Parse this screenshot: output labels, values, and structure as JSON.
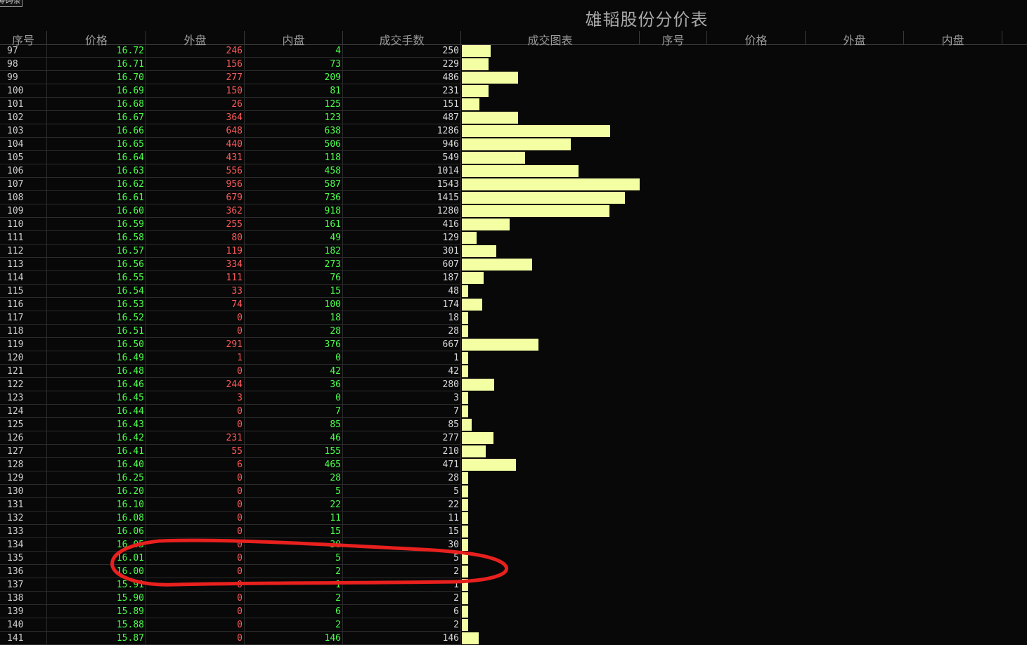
{
  "top_button": "筹码条",
  "title": "雄韬股份分价表",
  "headers_left": [
    "序号",
    "价格",
    "外盘",
    "内盘",
    "成交手数",
    "成交图表"
  ],
  "headers_right": [
    "序号",
    "价格",
    "外盘",
    "内盘"
  ],
  "colors": {
    "background": "#080808",
    "price": "#4cff4c",
    "outer": "#ff5a5a",
    "inner": "#4cff4c",
    "bar": "#f4ffa4",
    "annotation": "#e8201e"
  },
  "bar_scale_max": 1543,
  "rows": [
    {
      "idx": "97",
      "price": "16.72",
      "out": "246",
      "in": "4",
      "vol": "250"
    },
    {
      "idx": "98",
      "price": "16.71",
      "out": "156",
      "in": "73",
      "vol": "229"
    },
    {
      "idx": "99",
      "price": "16.70",
      "out": "277",
      "in": "209",
      "vol": "486"
    },
    {
      "idx": "100",
      "price": "16.69",
      "out": "150",
      "in": "81",
      "vol": "231"
    },
    {
      "idx": "101",
      "price": "16.68",
      "out": "26",
      "in": "125",
      "vol": "151"
    },
    {
      "idx": "102",
      "price": "16.67",
      "out": "364",
      "in": "123",
      "vol": "487"
    },
    {
      "idx": "103",
      "price": "16.66",
      "out": "648",
      "in": "638",
      "vol": "1286"
    },
    {
      "idx": "104",
      "price": "16.65",
      "out": "440",
      "in": "506",
      "vol": "946"
    },
    {
      "idx": "105",
      "price": "16.64",
      "out": "431",
      "in": "118",
      "vol": "549"
    },
    {
      "idx": "106",
      "price": "16.63",
      "out": "556",
      "in": "458",
      "vol": "1014"
    },
    {
      "idx": "107",
      "price": "16.62",
      "out": "956",
      "in": "587",
      "vol": "1543"
    },
    {
      "idx": "108",
      "price": "16.61",
      "out": "679",
      "in": "736",
      "vol": "1415"
    },
    {
      "idx": "109",
      "price": "16.60",
      "out": "362",
      "in": "918",
      "vol": "1280"
    },
    {
      "idx": "110",
      "price": "16.59",
      "out": "255",
      "in": "161",
      "vol": "416"
    },
    {
      "idx": "111",
      "price": "16.58",
      "out": "80",
      "in": "49",
      "vol": "129"
    },
    {
      "idx": "112",
      "price": "16.57",
      "out": "119",
      "in": "182",
      "vol": "301"
    },
    {
      "idx": "113",
      "price": "16.56",
      "out": "334",
      "in": "273",
      "vol": "607"
    },
    {
      "idx": "114",
      "price": "16.55",
      "out": "111",
      "in": "76",
      "vol": "187"
    },
    {
      "idx": "115",
      "price": "16.54",
      "out": "33",
      "in": "15",
      "vol": "48"
    },
    {
      "idx": "116",
      "price": "16.53",
      "out": "74",
      "in": "100",
      "vol": "174"
    },
    {
      "idx": "117",
      "price": "16.52",
      "out": "0",
      "in": "18",
      "vol": "18"
    },
    {
      "idx": "118",
      "price": "16.51",
      "out": "0",
      "in": "28",
      "vol": "28"
    },
    {
      "idx": "119",
      "price": "16.50",
      "out": "291",
      "in": "376",
      "vol": "667"
    },
    {
      "idx": "120",
      "price": "16.49",
      "out": "1",
      "in": "0",
      "vol": "1"
    },
    {
      "idx": "121",
      "price": "16.48",
      "out": "0",
      "in": "42",
      "vol": "42"
    },
    {
      "idx": "122",
      "price": "16.46",
      "out": "244",
      "in": "36",
      "vol": "280"
    },
    {
      "idx": "123",
      "price": "16.45",
      "out": "3",
      "in": "0",
      "vol": "3"
    },
    {
      "idx": "124",
      "price": "16.44",
      "out": "0",
      "in": "7",
      "vol": "7"
    },
    {
      "idx": "125",
      "price": "16.43",
      "out": "0",
      "in": "85",
      "vol": "85"
    },
    {
      "idx": "126",
      "price": "16.42",
      "out": "231",
      "in": "46",
      "vol": "277"
    },
    {
      "idx": "127",
      "price": "16.41",
      "out": "55",
      "in": "155",
      "vol": "210"
    },
    {
      "idx": "128",
      "price": "16.40",
      "out": "6",
      "in": "465",
      "vol": "471"
    },
    {
      "idx": "129",
      "price": "16.25",
      "out": "0",
      "in": "28",
      "vol": "28"
    },
    {
      "idx": "130",
      "price": "16.20",
      "out": "0",
      "in": "5",
      "vol": "5"
    },
    {
      "idx": "131",
      "price": "16.10",
      "out": "0",
      "in": "22",
      "vol": "22"
    },
    {
      "idx": "132",
      "price": "16.08",
      "out": "0",
      "in": "11",
      "vol": "11"
    },
    {
      "idx": "133",
      "price": "16.06",
      "out": "0",
      "in": "15",
      "vol": "15"
    },
    {
      "idx": "134",
      "price": "16.05",
      "out": "0",
      "in": "30",
      "vol": "30"
    },
    {
      "idx": "135",
      "price": "16.01",
      "out": "0",
      "in": "5",
      "vol": "5"
    },
    {
      "idx": "136",
      "price": "16.00",
      "out": "0",
      "in": "2",
      "vol": "2"
    },
    {
      "idx": "137",
      "price": "15.91",
      "out": "0",
      "in": "1",
      "vol": "1"
    },
    {
      "idx": "138",
      "price": "15.90",
      "out": "0",
      "in": "2",
      "vol": "2"
    },
    {
      "idx": "139",
      "price": "15.89",
      "out": "0",
      "in": "6",
      "vol": "6"
    },
    {
      "idx": "140",
      "price": "15.88",
      "out": "0",
      "in": "2",
      "vol": "2"
    },
    {
      "idx": "141",
      "price": "15.87",
      "out": "0",
      "in": "146",
      "vol": "146"
    }
  ]
}
